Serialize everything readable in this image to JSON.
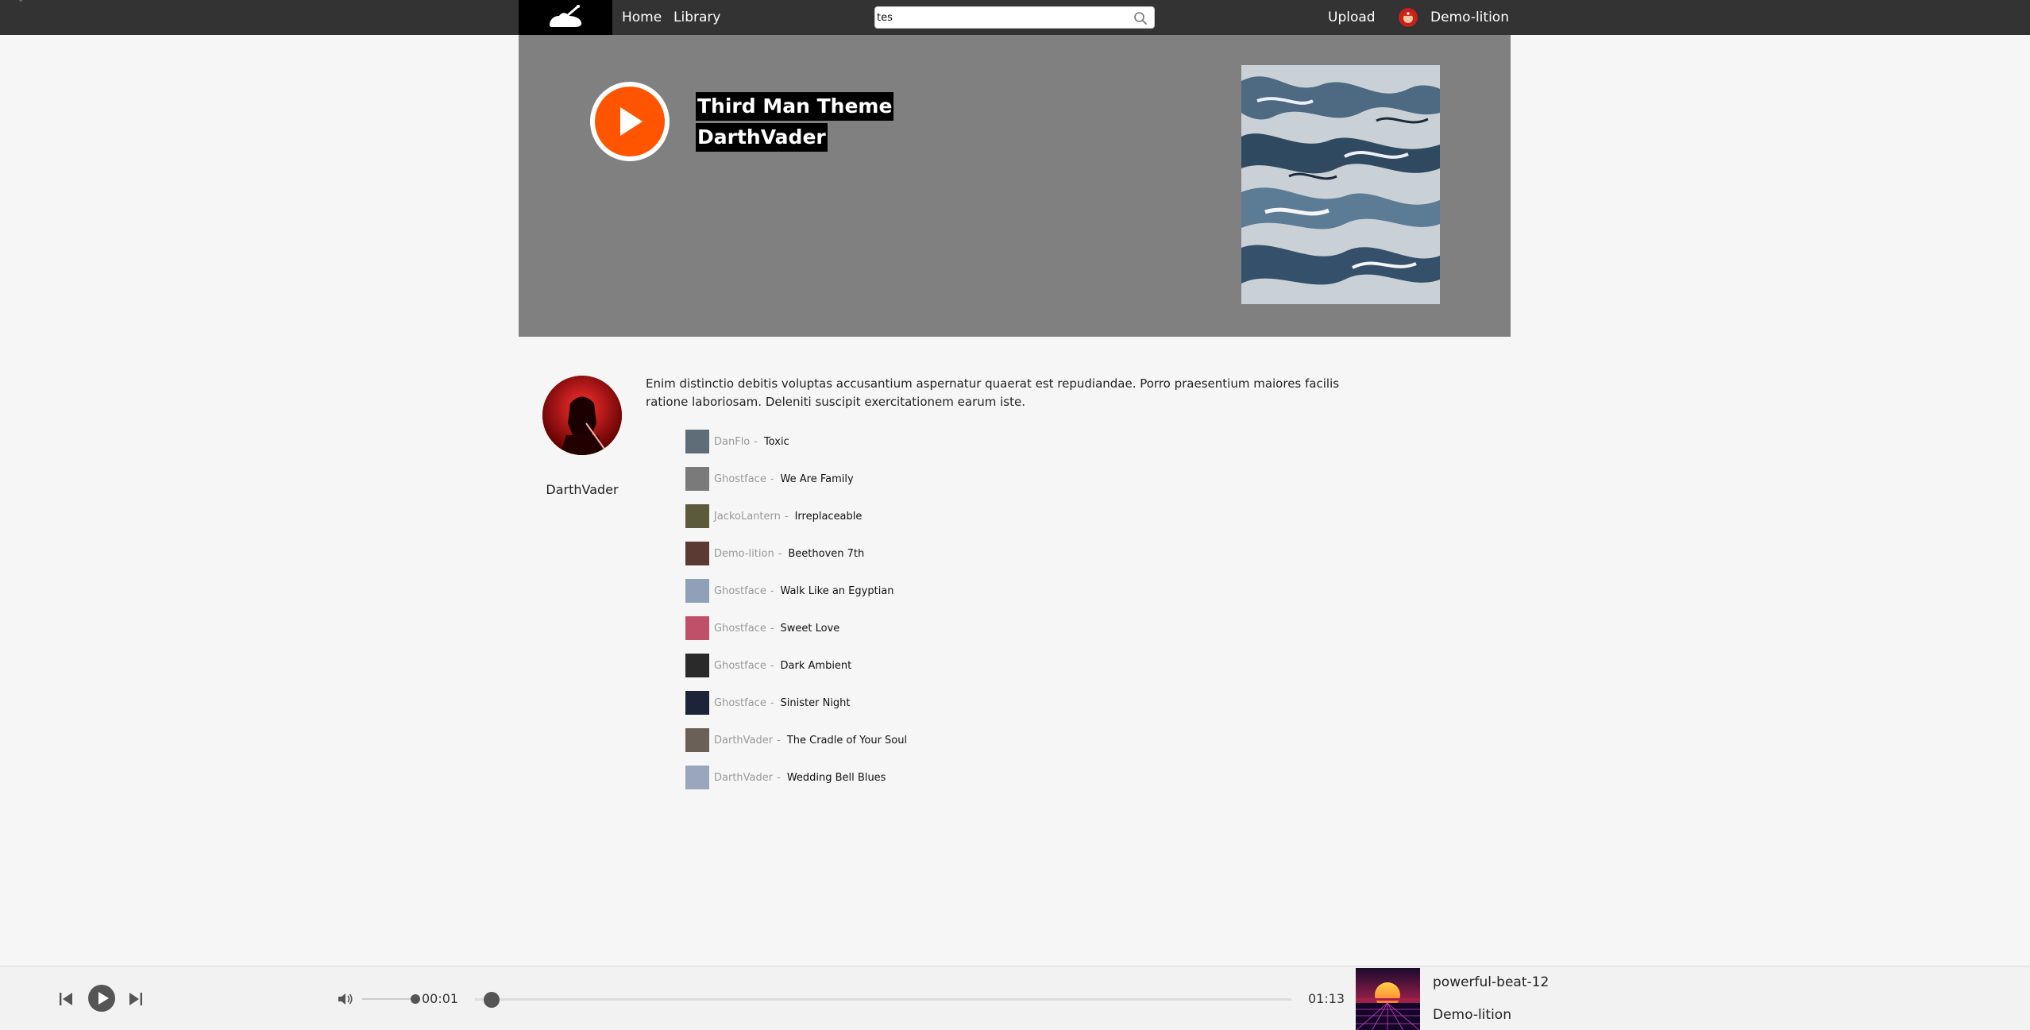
{
  "nav": {
    "home_label": "Home",
    "library_label": "Library",
    "upload_label": "Upload",
    "username": "Demo-lition",
    "search": {
      "value": "tes",
      "placeholder": ""
    }
  },
  "hero": {
    "track_title": "Third Man Theme",
    "artist": "DarthVader"
  },
  "artist": {
    "name": "DarthVader",
    "description": "Enim distinctio debitis voluptas accusantium aspernatur quaerat est repudiandae. Porro praesentium maiores facilis ratione laboriosam. Deleniti suscipit exercitationem earum iste."
  },
  "tracks": [
    {
      "user": "DanFlo",
      "separator": "-",
      "title": "Toxic",
      "thumb_color": "#5f6d78"
    },
    {
      "user": "Ghostface",
      "separator": "-",
      "title": "We Are Family",
      "thumb_color": "#7a7a7a"
    },
    {
      "user": "JackoLantern",
      "separator": "-",
      "title": "Irreplaceable",
      "thumb_color": "#5b5a3a"
    },
    {
      "user": "Demo-lition",
      "separator": "-",
      "title": "Beethoven 7th",
      "thumb_color": "#5a3a32"
    },
    {
      "user": "Ghostface",
      "separator": "-",
      "title": "Walk Like an Egyptian",
      "thumb_color": "#8fa0b8"
    },
    {
      "user": "Ghostface",
      "separator": "-",
      "title": "Sweet Love",
      "thumb_color": "#c0506a"
    },
    {
      "user": "Ghostface",
      "separator": "-",
      "title": "Dark Ambient",
      "thumb_color": "#2a2a2a"
    },
    {
      "user": "Ghostface",
      "separator": "-",
      "title": "Sinister Night",
      "thumb_color": "#1e2438"
    },
    {
      "user": "DarthVader",
      "separator": "-",
      "title": "The Cradle of Your Soul",
      "thumb_color": "#6a6058"
    },
    {
      "user": "DarthVader",
      "separator": "-",
      "title": "Wedding Bell Blues",
      "thumb_color": "#9aa6bc"
    }
  ],
  "player": {
    "current_time": "00:01",
    "total_time": "01:13",
    "progress_fraction": 0.014,
    "volume_fraction": 0.9,
    "now_playing_title": "powerful-beat-12",
    "now_playing_artist": "Demo-lition"
  },
  "colors": {
    "accent": "#ff5500",
    "topbar": "#333333",
    "hero_bg": "#808080"
  },
  "icons": {
    "logo": "shoe-logo-icon",
    "search": "search-icon",
    "play": "play-icon",
    "prev": "skip-previous-icon",
    "next": "skip-next-icon",
    "volume": "volume-icon"
  }
}
